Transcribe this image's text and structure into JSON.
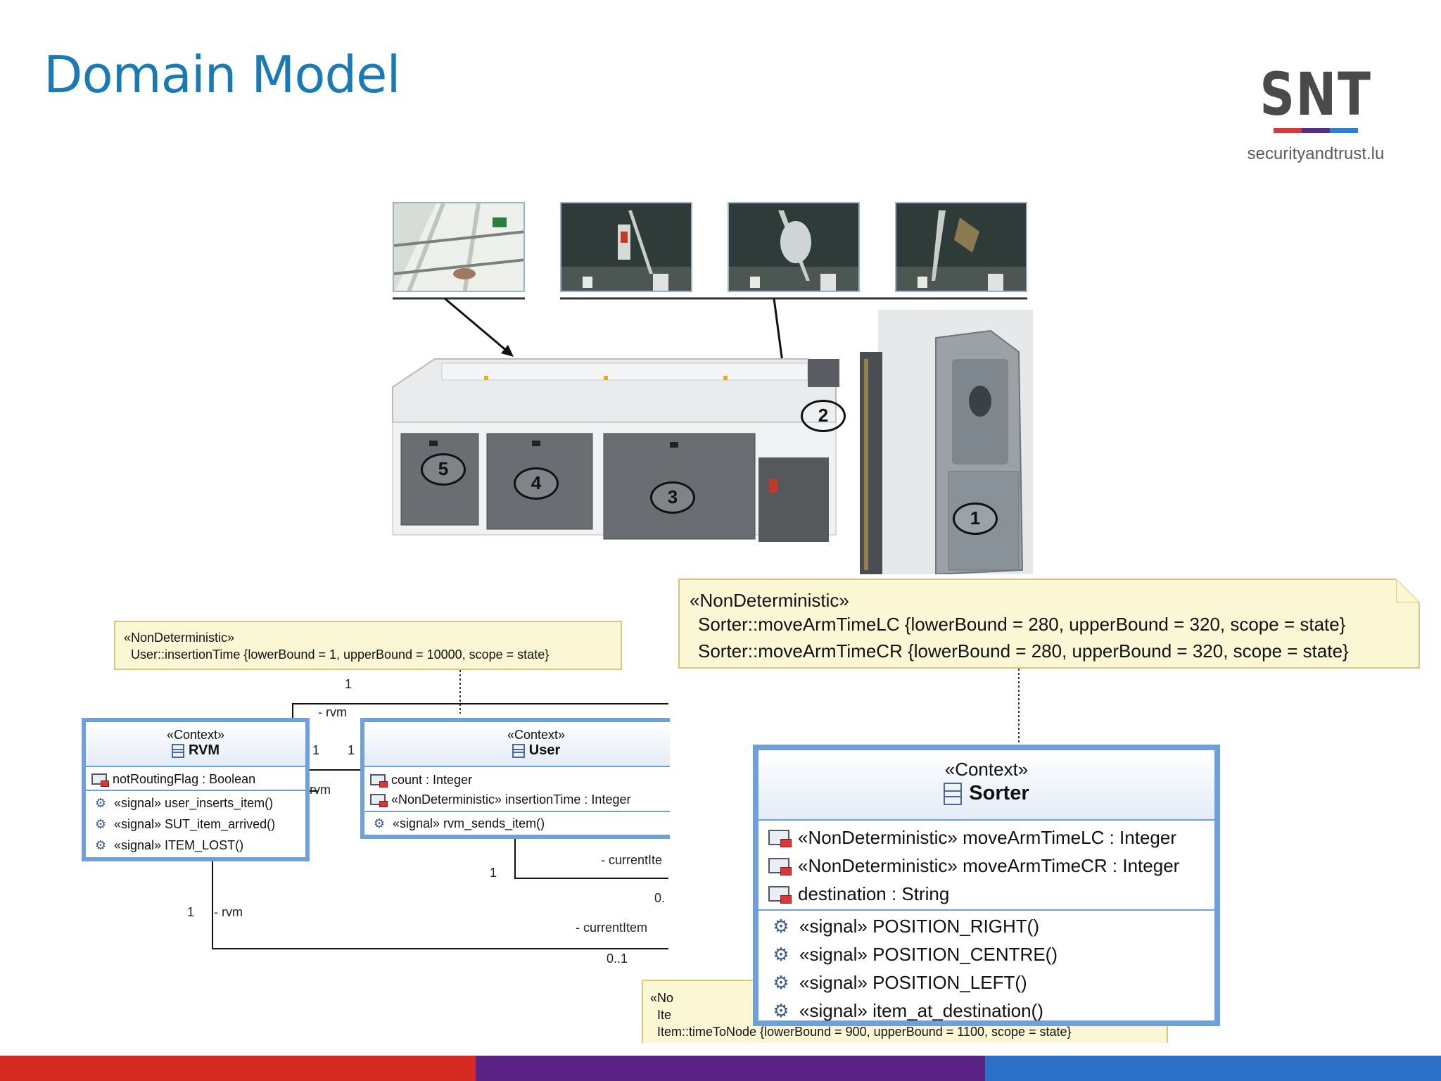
{
  "slide": {
    "title": "Domain Model"
  },
  "logo": {
    "mark": "SNT",
    "url": "securityandtrust.lu",
    "bar_colors": [
      "#d9383a",
      "#5a2a8a",
      "#2f7fd0"
    ]
  },
  "footer": {
    "colors": [
      "#d62b22",
      "#5b2385",
      "#2c6fc6"
    ]
  },
  "machine": {
    "callouts": [
      "1",
      "2",
      "3",
      "4",
      "5"
    ]
  },
  "note_user": {
    "stereotype": "«NonDeterministic»",
    "lines": [
      "User::insertionTime {lowerBound = 1, upperBound = 10000, scope = state}"
    ]
  },
  "note_sorter": {
    "stereotype": "«NonDeterministic»",
    "lines": [
      "Sorter::moveArmTimeLC {lowerBound = 280, upperBound = 320, scope = state}",
      "Sorter::moveArmTimeCR {lowerBound = 280, upperBound = 320, scope = state}"
    ]
  },
  "note_item": {
    "stereotype": "«No",
    "line1": "Ite",
    "line2": "Item::timeToNode {lowerBound = 900, upperBound = 1100, scope = state}"
  },
  "rvm_class": {
    "stereotype": "«Context»",
    "name": "RVM",
    "attributes": [
      "notRoutingFlag : Boolean"
    ],
    "operations": [
      "«signal» user_inserts_item()",
      "«signal» SUT_item_arrived()",
      "«signal» ITEM_LOST()"
    ]
  },
  "user_class": {
    "stereotype": "«Context»",
    "name": "User",
    "attributes": [
      "count : Integer",
      "«NonDeterministic» insertionTime : Integer"
    ],
    "operations": [
      "«signal» rvm_sends_item()"
    ]
  },
  "sorter_class": {
    "stereotype": "«Context»",
    "name": "Sorter",
    "attributes": [
      "«NonDeterministic» moveArmTimeLC : Integer",
      "«NonDeterministic» moveArmTimeCR : Integer",
      "destination : String"
    ],
    "operations": [
      "«signal» POSITION_RIGHT()",
      "«signal» POSITION_CENTRE()",
      "«signal» POSITION_LEFT()",
      "«signal» item_at_destination()"
    ]
  },
  "associations": {
    "top_mult": "1",
    "top_role": "- rvm",
    "rvm_user_left": "1",
    "rvm_user_right": "1",
    "rvm_side_role": "rvm",
    "user_item_mult": "1",
    "user_item_role": "- currentIte",
    "user_item_target": "0.",
    "rvm_item_mult": "1",
    "rvm_item_role": "- rvm",
    "rvm_item_target_role": "- currentItem",
    "rvm_item_target": "0..1"
  }
}
